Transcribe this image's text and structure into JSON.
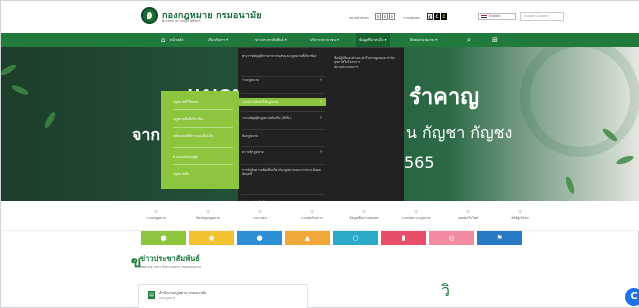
{
  "header": {
    "site_title": "กองกฎหมาย กรมอนามัย",
    "site_subtitle": "Bureau of Legal Affairs",
    "font_size_label": "ขนาดตัวอักษร",
    "font_buttons": [
      "ก",
      "ก",
      "ก"
    ],
    "contrast_label": "การแสดงผล",
    "contrast_buttons": [
      "C",
      "C",
      "C"
    ],
    "language": "English",
    "search_placeholder": "Google Custom"
  },
  "nav": {
    "items": [
      {
        "label": "หน้าหลัก"
      },
      {
        "label": "เกี่ยวกับเรา ▾"
      },
      {
        "label": "ข่าวประชาสัมพันธ์ ▾"
      },
      {
        "label": "บริการประชาชน ▾"
      },
      {
        "label": "ข้อมูลที่น่าสนใจ ▾"
      },
      {
        "label": "ติดต่อหน่วยงาน ▾"
      }
    ],
    "search_icon": "search-icon",
    "sitemap_icon": "sitemap-icon"
  },
  "hero": {
    "line1_left": "แนวทาง",
    "line1_right": "รำคาญ",
    "line2_left": "จาก",
    "line2_right": "น กัญชา กัญชง",
    "line3_right": "565"
  },
  "dropdown": {
    "col1": [
      {
        "label": "พระราชบัญญัติการสาธารณสุขและกฎหมายที่เกี่ยวข้อง",
        "arrow": ""
      },
      {
        "label": "ร่างกฎหมาย",
        "arrow": "›"
      },
      {
        "label": "ระบบการบังคับใช้กฎหมาย",
        "arrow": "›"
      },
      {
        "label": "ระบบบัญญัติกฎหมายท้องถิ่น (HIRL)",
        "arrow": "›"
      },
      {
        "label": "ข้อกฎหมาย",
        "arrow": ""
      },
      {
        "label": "ความรู้กฎหมาย",
        "arrow": "›"
      },
      {
        "label": "การรับฟังความคิดเห็นเกี่ยวกับกฎหมายและการประเมินผลสัมฤทธิ์",
        "arrow": ""
      },
      {
        "label": "ประกาศ / แจ้งเวียนหน่วยงาน",
        "arrow": ""
      }
    ],
    "col2": [
      "ข้อปฏิบัติและคำแนะนำในการดูแลและกำกับสุขภาพในโครงการ",
      "สถานประกอบการ"
    ],
    "submenu": [
      "กฎหมายที่ใช้บังคับ",
      "กฎหมายอื่นที่เกี่ยวข้อง",
      "หลักเกณฑ์วิธีการและเงื่อนไข",
      "ตัวอย่างข้อบัญญัติ",
      "คำสั่งศาลปกครอง",
      "กฎหมายอื่น"
    ]
  },
  "quick_links": [
    {
      "label": "ระบบกฎหมาย",
      "icon": "book-icon"
    },
    {
      "label": "ห้องสมุดกฎหมาย",
      "icon": "library-icon"
    },
    {
      "label": "ถาม-ตอบ",
      "icon": "chat-icon"
    },
    {
      "label": "แบบฟอร์มต่างๆ",
      "icon": "form-icon"
    },
    {
      "label": "ข้อมูลเพื่อการเผยแพร่",
      "icon": "info-icon"
    },
    {
      "label": "ระบบจัดการกฎหมาย",
      "icon": "gear-icon"
    },
    {
      "label": "แผนผังเว็บไซต์",
      "icon": "sitemap-icon"
    },
    {
      "label": "สถิติผู้เข้าชม",
      "icon": "stats-icon"
    }
  ],
  "color_bar": [
    {
      "color": "#8cc63f",
      "icon": "message-icon",
      "glyph": "●"
    },
    {
      "color": "#f2c230",
      "icon": "globe-icon",
      "glyph": "◉"
    },
    {
      "color": "#2c8fd6",
      "icon": "user-icon",
      "glyph": "●"
    },
    {
      "color": "#f0a83a",
      "icon": "rocket-icon",
      "glyph": "▲"
    },
    {
      "color": "#2aa9c9",
      "icon": "search-icon",
      "glyph": "○"
    },
    {
      "color": "#e84e6a",
      "icon": "doc-icon",
      "glyph": "▮"
    },
    {
      "color": "#f28ba0",
      "icon": "target-icon",
      "glyph": "◎"
    },
    {
      "color": "#2a79c4",
      "icon": "flag-icon",
      "glyph": "⚑"
    }
  ],
  "news": {
    "title": "ข่าวประชาสัมพันธ์",
    "subtitle": "ติดตามข่าวสาร กิจกรรมต่างๆ ของหน่วยงาน",
    "card_title": "สำนักงานกฎหมาย กรมอนามัย",
    "card_sub": "กองกฎหมาย"
  },
  "colors": {
    "primary": "#1f7a3c",
    "menu_accent": "#8cc63f",
    "menu_bg": "#222222"
  }
}
